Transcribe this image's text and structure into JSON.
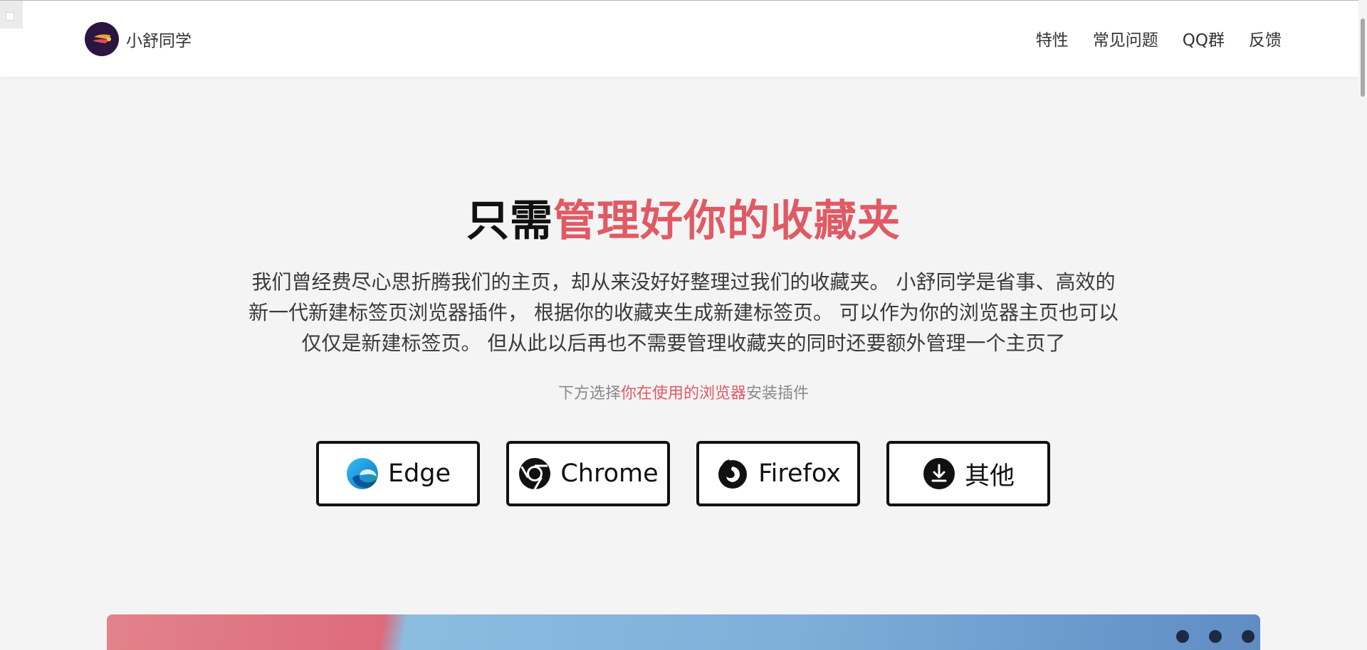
{
  "brand": {
    "name": "小舒同学"
  },
  "nav": {
    "items": [
      {
        "label": "特性"
      },
      {
        "label": "常见问题"
      },
      {
        "label": "QQ群"
      },
      {
        "label": "反馈"
      }
    ]
  },
  "hero": {
    "title_plain": "只需",
    "title_accent": "管理好你的收藏夹",
    "description": "我们曾经费尽心思折腾我们的主页，却从来没好好整理过我们的收藏夹。 小舒同学是省事、高效的新一代新建标签页浏览器插件， 根据你的收藏夹生成新建标签页。 可以作为你的浏览器主页也可以仅仅是新建标签页。 但从此以后再也不需要管理收藏夹的同时还要额外管理一个主页了",
    "hint_before": "下方选择",
    "hint_accent": "你在使用的浏览器",
    "hint_after": "安装插件"
  },
  "browsers": [
    {
      "label": "Edge",
      "icon": "edge-icon"
    },
    {
      "label": "Chrome",
      "icon": "chrome-icon"
    },
    {
      "label": "Firefox",
      "icon": "firefox-icon"
    },
    {
      "label": "其他",
      "icon": "download-icon"
    }
  ],
  "colors": {
    "accent": "#e05a64",
    "text": "#333333",
    "background": "#f4f4f4"
  }
}
